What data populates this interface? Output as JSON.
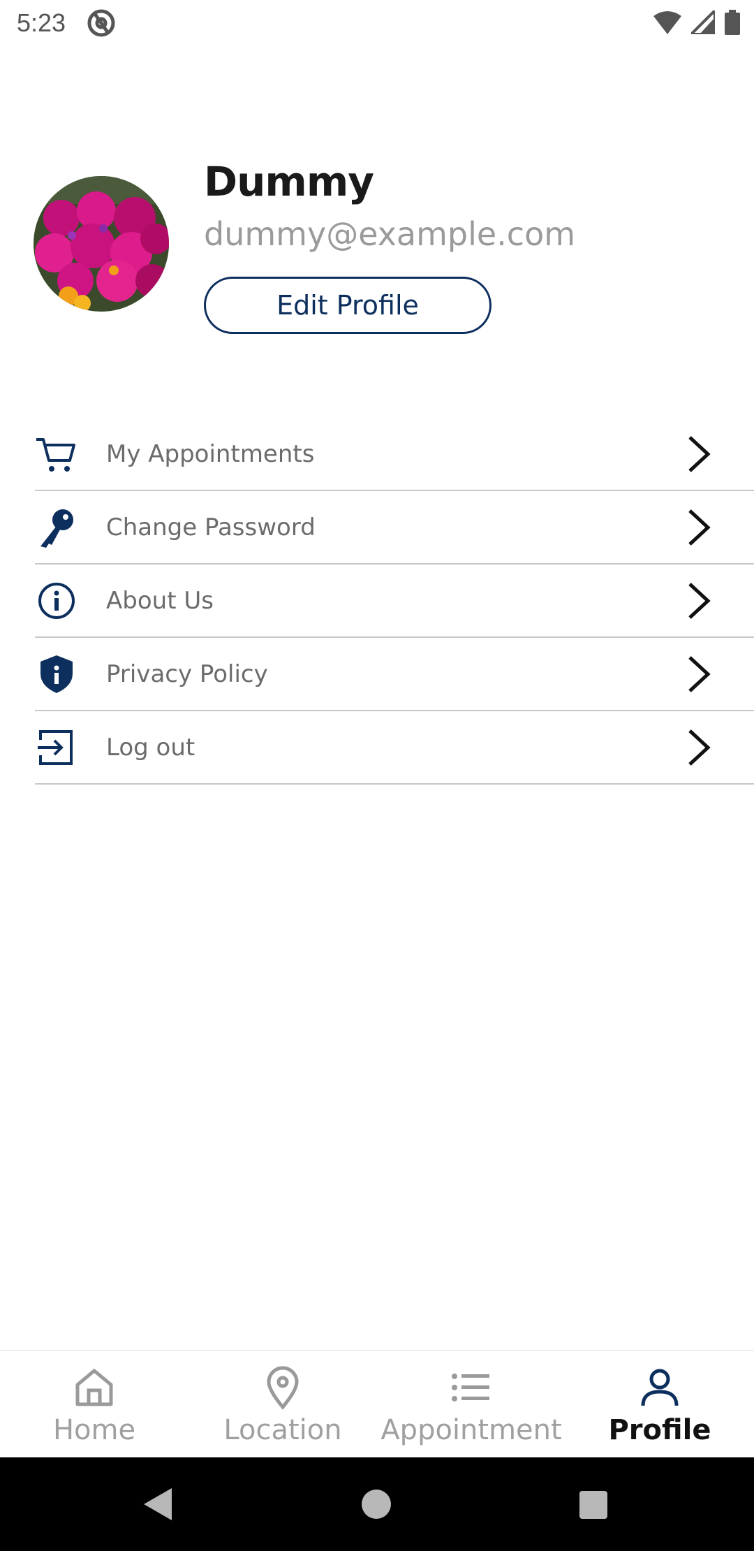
{
  "status_bar": {
    "time": "5:23"
  },
  "profile": {
    "name": "Dummy",
    "email": "dummy@example.com",
    "edit_label": "Edit Profile"
  },
  "menu": {
    "items": [
      {
        "label": "My Appointments",
        "icon": "cart-icon"
      },
      {
        "label": "Change Password",
        "icon": "key-icon"
      },
      {
        "label": "About Us",
        "icon": "info-icon"
      },
      {
        "label": "Privacy Policy",
        "icon": "shield-icon"
      },
      {
        "label": "Log out",
        "icon": "logout-icon"
      }
    ]
  },
  "bottom_nav": {
    "items": [
      {
        "label": "Home",
        "icon": "home-icon",
        "active": false
      },
      {
        "label": "Location",
        "icon": "location-pin-icon",
        "active": false
      },
      {
        "label": "Appointment",
        "icon": "list-icon",
        "active": false
      },
      {
        "label": "Profile",
        "icon": "person-icon",
        "active": true
      }
    ]
  },
  "colors": {
    "accent": "#0d2f5e",
    "muted_text": "#6b6b6b",
    "divider": "#c8c8c8"
  }
}
